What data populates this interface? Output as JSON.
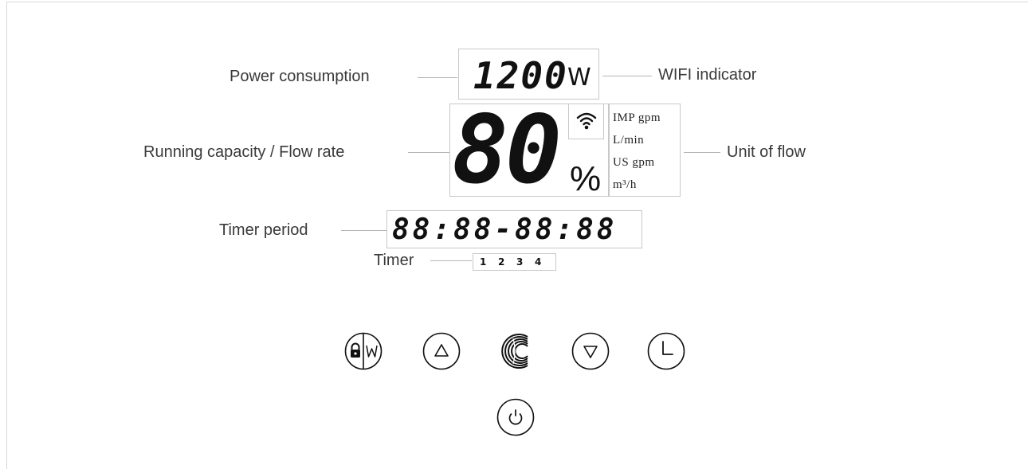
{
  "labels": {
    "power_consumption": "Power consumption",
    "wifi_indicator": "WIFI indicator",
    "running_capacity": "Running capacity / Flow rate",
    "unit_of_flow": "Unit of flow",
    "timer_period": "Timer period",
    "timer": "Timer"
  },
  "display": {
    "power_value": "1200",
    "power_unit": "W",
    "capacity_value": "80",
    "capacity_unit": "%",
    "flow_units": [
      "IMP gpm",
      "L/min",
      "US gpm",
      "m³/h"
    ],
    "timer_period_value": "88:88-88:88",
    "timer_slots": [
      "1",
      "2",
      "3",
      "4"
    ]
  },
  "buttons": [
    {
      "name": "lock-wifi-button",
      "icon": "lock-wifi-icon"
    },
    {
      "name": "up-button",
      "icon": "triangle-up-icon"
    },
    {
      "name": "mode-button",
      "icon": "brand-swirl-icon"
    },
    {
      "name": "down-button",
      "icon": "triangle-down-icon"
    },
    {
      "name": "timer-button",
      "icon": "clock-icon"
    },
    {
      "name": "power-button",
      "icon": "power-icon"
    }
  ],
  "colors": {
    "display_text": "#111111",
    "label_text": "#3a3a3a",
    "leader_lines": "#b5b5b5"
  }
}
